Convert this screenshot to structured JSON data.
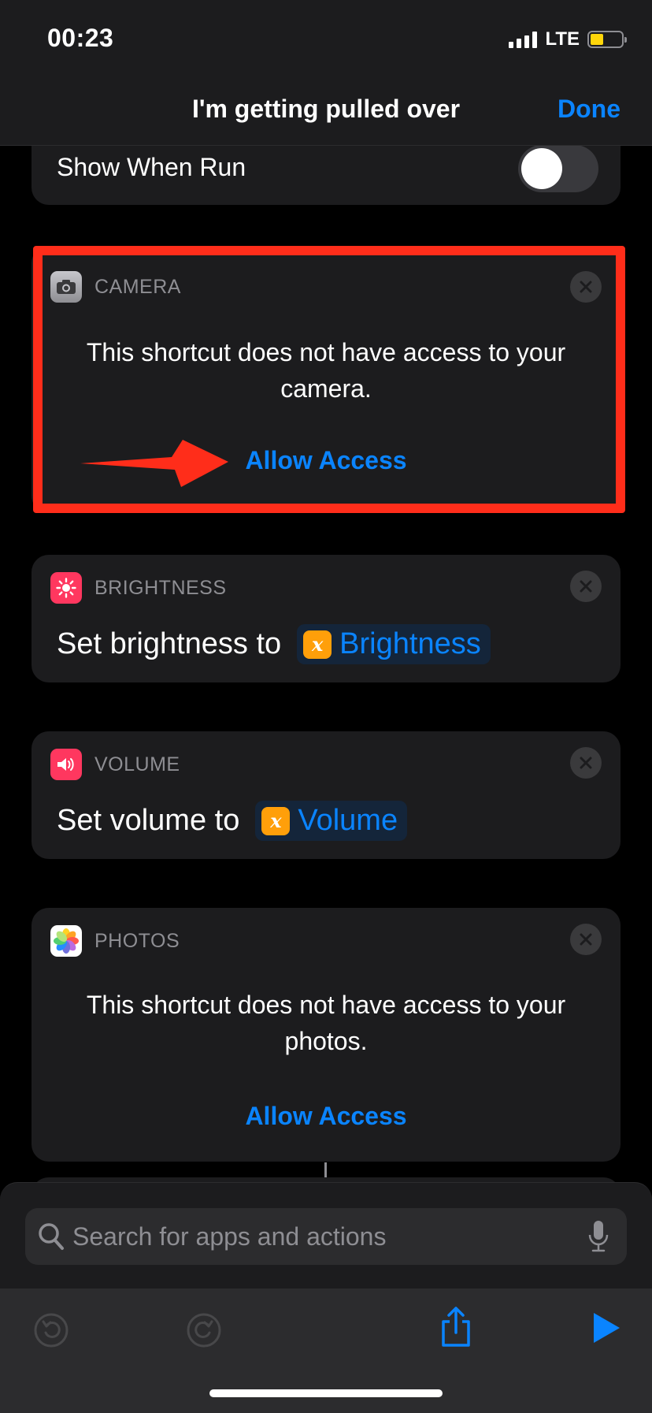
{
  "status_bar": {
    "time": "00:23",
    "network": "LTE"
  },
  "nav": {
    "title": "I'm getting pulled over",
    "done_label": "Done"
  },
  "show_when_run": {
    "label": "Show When Run",
    "enabled": false
  },
  "actions": [
    {
      "title": "CAMERA",
      "icon": "camera-icon",
      "message": "This shortcut does not have access to your camera.",
      "allow_label": "Allow Access"
    },
    {
      "title": "BRIGHTNESS",
      "icon": "sun-icon",
      "text": "Set brightness to",
      "variable_label": "Brightness"
    },
    {
      "title": "VOLUME",
      "icon": "speaker-icon",
      "text": "Set volume to",
      "variable_label": "Volume"
    },
    {
      "title": "PHOTOS",
      "icon": "photos-icon",
      "message": "This shortcut does not have access to your photos.",
      "allow_label": "Allow Access"
    }
  ],
  "search": {
    "placeholder": "Search for apps and actions"
  },
  "toolbar": {
    "buttons": [
      "undo-icon",
      "redo-icon",
      "share-icon",
      "play-icon"
    ]
  },
  "colors": {
    "accent": "#0a84ff",
    "highlight": "#ff2d1a",
    "variable": "#ff9f0a"
  }
}
